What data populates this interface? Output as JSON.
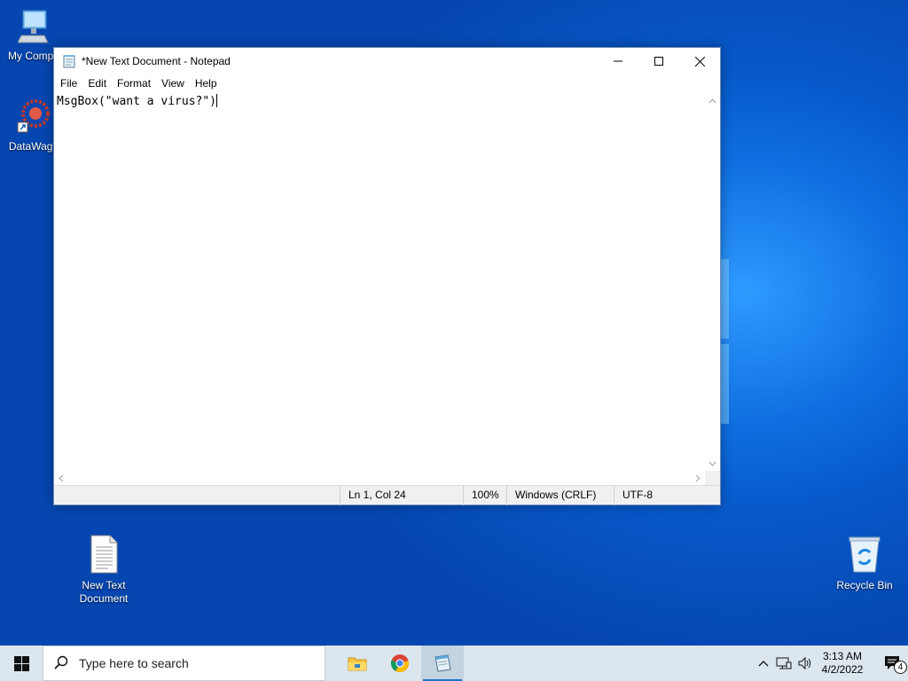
{
  "desktop": {
    "icons": [
      {
        "label": "My Compu",
        "icon": "computer-icon"
      },
      {
        "label": "DataWago",
        "icon": "datawagon-icon"
      },
      {
        "label": "New Text Document",
        "icon": "text-document-icon"
      },
      {
        "label": "Recycle Bin",
        "icon": "recycle-bin-icon"
      }
    ]
  },
  "notepad": {
    "title": "*New Text Document - Notepad",
    "menu": [
      "File",
      "Edit",
      "Format",
      "View",
      "Help"
    ],
    "content": "MsgBox(\"want a virus?\")",
    "status": {
      "position": "Ln 1, Col 24",
      "zoom": "100%",
      "line_ending": "Windows (CRLF)",
      "encoding": "UTF-8"
    }
  },
  "taskbar": {
    "search_placeholder": "Type here to search",
    "apps": [
      "file-explorer-icon",
      "chrome-icon",
      "notepad-icon"
    ],
    "clock": {
      "time": "3:13 AM",
      "date": "4/2/2022"
    },
    "notification_count": "4"
  },
  "colors": {
    "taskbar": "#dce6ee",
    "desktop_accent": "#0f6fe0",
    "active_underline": "#1e73c9"
  }
}
